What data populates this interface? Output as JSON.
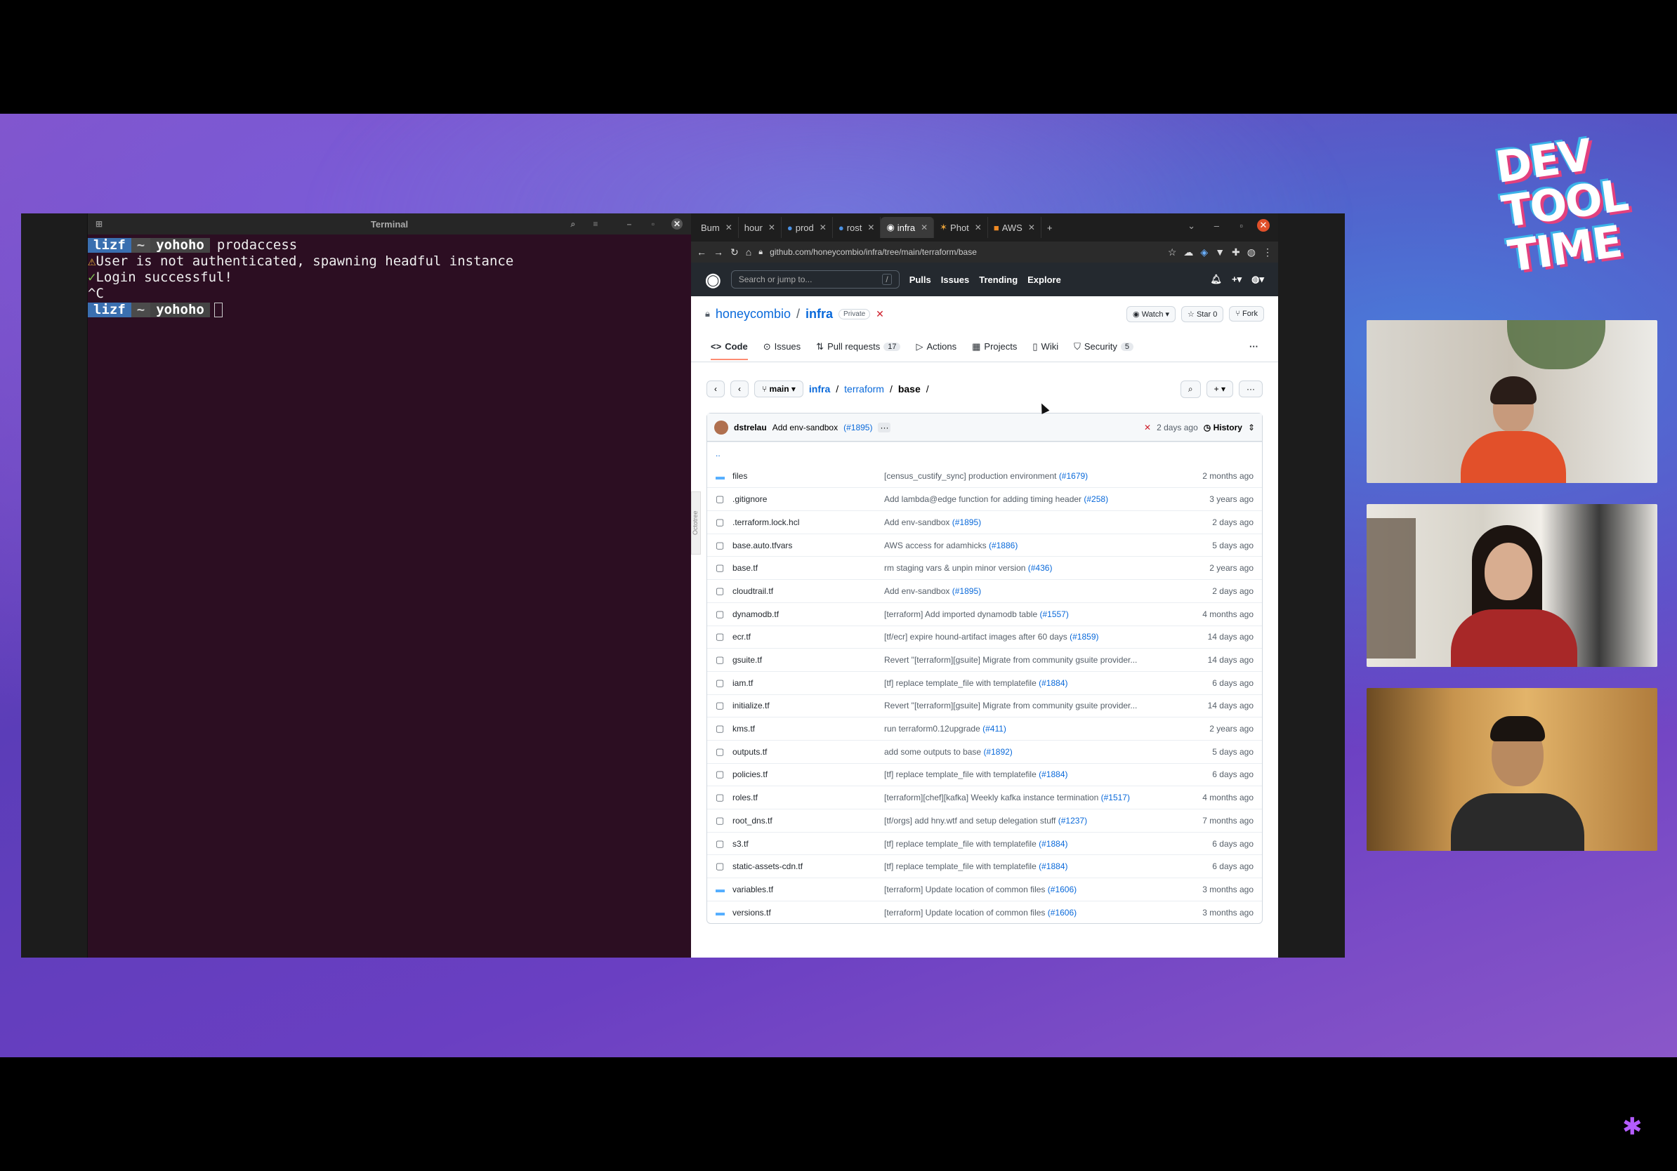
{
  "branding": {
    "logo_lines": [
      "DEV",
      "TOOL",
      "TIME"
    ]
  },
  "terminal": {
    "title": "Terminal",
    "lines": [
      {
        "user": "lizf",
        "home": "~",
        "dir": "yohoho",
        "cmd": "prodaccess"
      },
      {
        "prefix": "⚠",
        "text": "User is not authenticated, spawning headful instance"
      },
      {
        "prefix": "✓",
        "text": "Login successful!"
      },
      {
        "text": "^C"
      },
      {
        "user": "lizf",
        "home": "~",
        "dir": "yohoho"
      }
    ]
  },
  "browser": {
    "tabs": [
      "Bum",
      "hour",
      "prod",
      "rost",
      "infra",
      "Phot",
      "AWS"
    ],
    "url": "github.com/honeycombio/infra/tree/main/terraform/base"
  },
  "github": {
    "search_placeholder": "Search or jump to...",
    "search_key": "/",
    "nav": [
      "Pulls",
      "Issues",
      "Trending",
      "Explore"
    ],
    "repo": {
      "owner": "honeycombio",
      "name": "infra",
      "visibility": "Private",
      "watch": "Watch",
      "star": "Star",
      "star_count": "0",
      "fork": "Fork"
    },
    "tabs": [
      {
        "label": "Code"
      },
      {
        "label": "Issues"
      },
      {
        "label": "Pull requests",
        "count": "17"
      },
      {
        "label": "Actions"
      },
      {
        "label": "Projects"
      },
      {
        "label": "Wiki"
      },
      {
        "label": "Security",
        "count": "5"
      }
    ],
    "branch": "main",
    "breadcrumb": {
      "root": "infra",
      "mid": "terraform",
      "current": "base",
      "trail": "/"
    },
    "commit": {
      "author": "dstrelau",
      "message": "Add env-sandbox",
      "pr": "(#1895)",
      "age": "2 days ago",
      "history": "History"
    },
    "parent_dir": "..",
    "files": [
      {
        "name": "files",
        "dir": true,
        "msg": "[census_custify_sync] production environment",
        "pr": "(#1679)",
        "date": "2 months ago"
      },
      {
        "name": ".gitignore",
        "msg": "Add lambda@edge function for adding timing header",
        "pr": "(#258)",
        "date": "3 years ago"
      },
      {
        "name": ".terraform.lock.hcl",
        "msg": "Add env-sandbox",
        "pr": "(#1895)",
        "date": "2 days ago"
      },
      {
        "name": "base.auto.tfvars",
        "msg": "AWS access for adamhicks",
        "pr": "(#1886)",
        "date": "5 days ago"
      },
      {
        "name": "base.tf",
        "msg": "rm staging vars & unpin minor version",
        "pr": "(#436)",
        "date": "2 years ago"
      },
      {
        "name": "cloudtrail.tf",
        "msg": "Add env-sandbox",
        "pr": "(#1895)",
        "date": "2 days ago"
      },
      {
        "name": "dynamodb.tf",
        "msg": "[terraform] Add imported dynamodb table",
        "pr": "(#1557)",
        "date": "4 months ago"
      },
      {
        "name": "ecr.tf",
        "msg": "[tf/ecr] expire hound-artifact images after 60 days",
        "pr": "(#1859)",
        "date": "14 days ago"
      },
      {
        "name": "gsuite.tf",
        "msg": "Revert \"[terraform][gsuite] Migrate from community gsuite provider...",
        "pr": "",
        "date": "14 days ago"
      },
      {
        "name": "iam.tf",
        "msg": "[tf] replace template_file with templatefile",
        "pr": "(#1884)",
        "date": "6 days ago"
      },
      {
        "name": "initialize.tf",
        "msg": "Revert \"[terraform][gsuite] Migrate from community gsuite provider...",
        "pr": "",
        "date": "14 days ago"
      },
      {
        "name": "kms.tf",
        "msg": "run terraform0.12upgrade",
        "pr": "(#411)",
        "date": "2 years ago"
      },
      {
        "name": "outputs.tf",
        "msg": "add some outputs to base",
        "pr": "(#1892)",
        "date": "5 days ago"
      },
      {
        "name": "policies.tf",
        "msg": "[tf] replace template_file with templatefile",
        "pr": "(#1884)",
        "date": "6 days ago"
      },
      {
        "name": "roles.tf",
        "msg": "[terraform][chef][kafka] Weekly kafka instance termination",
        "pr": "(#1517)",
        "date": "4 months ago"
      },
      {
        "name": "root_dns.tf",
        "msg": "[tf/orgs] add hny.wtf and setup delegation stuff",
        "pr": "(#1237)",
        "date": "7 months ago"
      },
      {
        "name": "s3.tf",
        "msg": "[tf] replace template_file with templatefile",
        "pr": "(#1884)",
        "date": "6 days ago"
      },
      {
        "name": "static-assets-cdn.tf",
        "msg": "[tf] replace template_file with templatefile",
        "pr": "(#1884)",
        "date": "6 days ago"
      },
      {
        "name": "variables.tf",
        "dir": true,
        "msg": "[terraform] Update location of common files",
        "pr": "(#1606)",
        "date": "3 months ago"
      },
      {
        "name": "versions.tf",
        "dir": true,
        "msg": "[terraform] Update location of common files",
        "pr": "(#1606)",
        "date": "3 months ago"
      }
    ],
    "octotree": "Octotree"
  },
  "colors": {
    "accent": "#0969da",
    "terminal_bg": "#2c0e22",
    "stage_purple": "#6a3fc2"
  }
}
